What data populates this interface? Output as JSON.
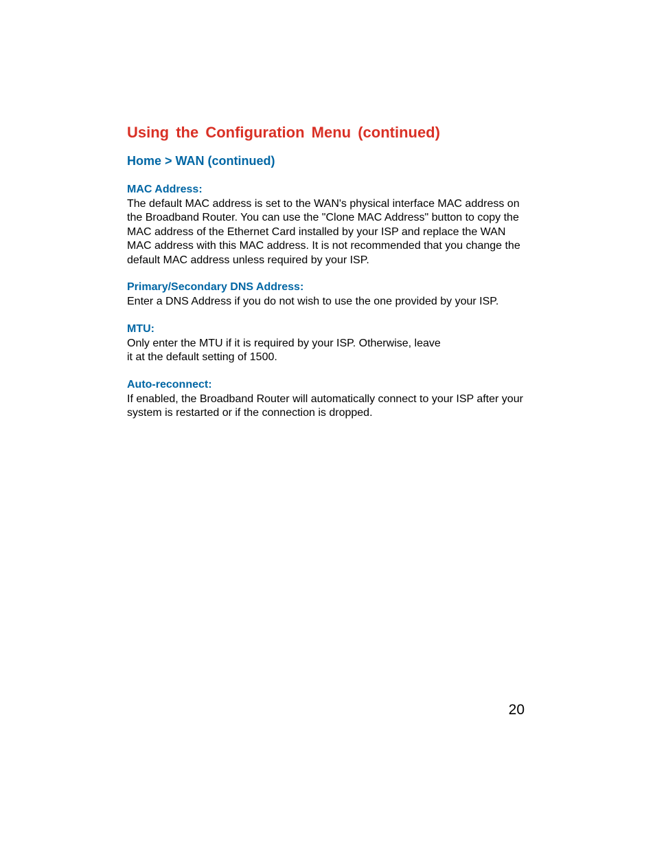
{
  "title": "Using the Configuration Menu (continued)",
  "breadcrumb": "Home > WAN (continued)",
  "sections": [
    {
      "heading": "MAC Address:",
      "body": "The default MAC address is set to the WAN's physical interface MAC address on the Broadband Router. You can use the \"Clone MAC Address\" button to copy the MAC address of the Ethernet Card installed by your ISP and replace the WAN MAC address with this MAC address. It is not recommended that you change the default MAC address unless required by your ISP."
    },
    {
      "heading": "Primary/Secondary DNS Address:",
      "body": "Enter a DNS Address if you do not wish to use the one provided by your ISP."
    },
    {
      "heading": "MTU:",
      "body": "Only enter the MTU if it is required by your ISP. Otherwise, leave it at the default setting of 1500."
    },
    {
      "heading": "Auto-reconnect:",
      "body": "If enabled, the Broadband Router will automatically connect to your ISP after your system is restarted or if the connection is dropped."
    }
  ],
  "pageNumber": "20"
}
